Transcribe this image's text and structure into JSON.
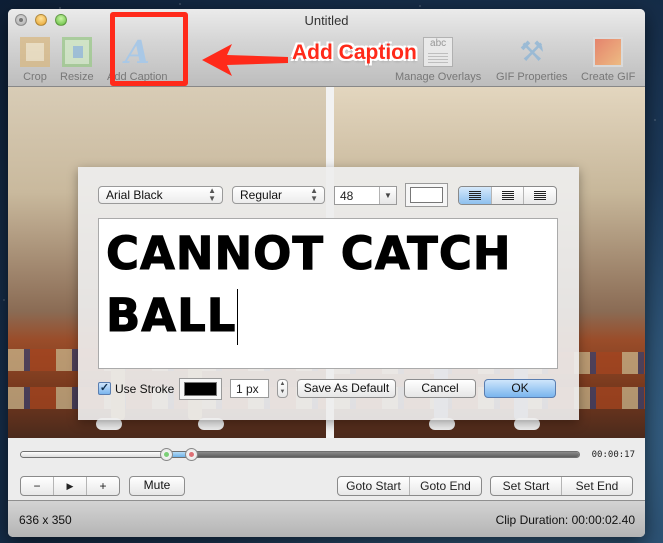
{
  "window": {
    "title": "Untitled"
  },
  "toolbar": {
    "items": [
      {
        "id": "crop",
        "label": "Crop",
        "icon": "crop-icon"
      },
      {
        "id": "resize",
        "label": "Resize",
        "icon": "resize-icon"
      },
      {
        "id": "add_caption",
        "label": "Add Caption",
        "icon": "caption-a-icon"
      },
      {
        "id": "manage_overlays",
        "label": "Manage Overlays",
        "icon": "abc-overlay-icon"
      },
      {
        "id": "gif_properties",
        "label": "GIF Properties",
        "icon": "tools-icon"
      },
      {
        "id": "create_gif",
        "label": "Create GIF",
        "icon": "image-gradient-icon"
      }
    ]
  },
  "annotation": {
    "label": "Add Caption",
    "color": "#ff2a1a"
  },
  "caption_dialog": {
    "font_family": "Arial Black",
    "font_style": "Regular",
    "font_size": "48",
    "fill_color": "#ffffff",
    "alignment_options": [
      "left",
      "center",
      "right"
    ],
    "alignment_selected": "left",
    "text_line1": "CANNOT CATCH",
    "text_line2": "BALL",
    "use_stroke_label": "Use Stroke",
    "use_stroke_checked": true,
    "stroke_color": "#000000",
    "stroke_width": "1 px",
    "save_default_label": "Save As Default",
    "cancel_label": "Cancel",
    "ok_label": "OK"
  },
  "playback": {
    "selection_start_fraction": 0.26,
    "selection_end_fraction": 0.305,
    "timecode": "00:00:17",
    "zoom_out_label": "−",
    "play_label": "▶",
    "zoom_in_label": "+",
    "mute_label": "Mute",
    "goto_start_label": "Goto Start",
    "goto_end_label": "Goto End",
    "set_start_label": "Set Start",
    "set_end_label": "Set End"
  },
  "status": {
    "dimensions": "636 x 350",
    "clip_duration": "Clip Duration: 00:00:02.40"
  }
}
